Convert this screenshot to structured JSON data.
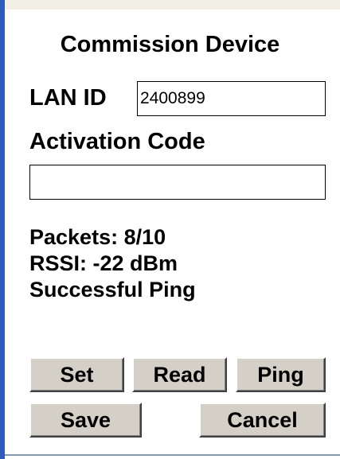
{
  "dialog": {
    "title": "Commission Device"
  },
  "form": {
    "lan_id_label": "LAN ID",
    "lan_id_value": "2400899",
    "activation_code_label": "Activation Code",
    "activation_code_value": ""
  },
  "status": {
    "packets": "Packets: 8/10",
    "rssi": "RSSI: -22 dBm",
    "message": "Successful Ping"
  },
  "buttons": {
    "set": "Set",
    "read": "Read",
    "ping": "Ping",
    "save": "Save",
    "cancel": "Cancel"
  },
  "colors": {
    "border_accent": "#2f5bbd",
    "button_face": "#d4d0c8"
  }
}
